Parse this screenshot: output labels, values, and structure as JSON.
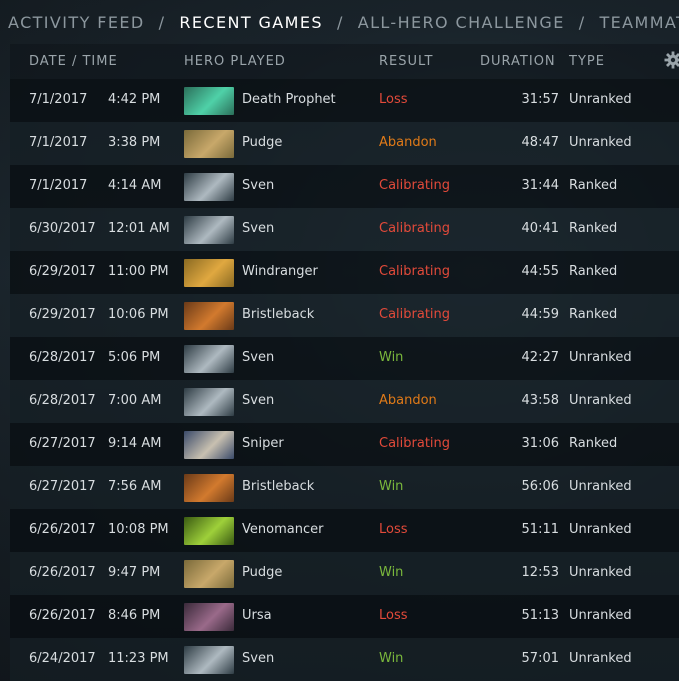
{
  "tabs": [
    {
      "label": "ACTIVITY FEED",
      "active": false
    },
    {
      "label": "RECENT GAMES",
      "active": true
    },
    {
      "label": "ALL-HERO CHALLENGE",
      "active": false
    },
    {
      "label": "TEAMMATES",
      "active": false
    }
  ],
  "tab_separator": "/",
  "columns": {
    "date_time": "DATE / TIME",
    "hero": "HERO PLAYED",
    "result": "RESULT",
    "duration": "DURATION",
    "type": "TYPE"
  },
  "settings_icon": "gear-icon",
  "result_colors": {
    "Loss": "#e24a3a",
    "Abandon": "#e07a18",
    "Calibrating": "#e24a3a",
    "Win": "#7ab83c"
  },
  "hero_colors": {
    "Death Prophet": [
      "#2b6f5a",
      "#4fd1a8"
    ],
    "Pudge": [
      "#7a6a3a",
      "#c8a86a"
    ],
    "Sven": [
      "#2e3c44",
      "#aeb9c0"
    ],
    "Windranger": [
      "#8a6a22",
      "#e0a840"
    ],
    "Bristleback": [
      "#6a3a18",
      "#d27a2e"
    ],
    "Sniper": [
      "#3a4a6a",
      "#c8c0b0"
    ],
    "Venomancer": [
      "#3a5a12",
      "#9ed03a"
    ],
    "Ursa": [
      "#3a2a3a",
      "#9a6a8a"
    ]
  },
  "matches": [
    {
      "date": "7/1/2017",
      "time": "4:42 PM",
      "hero": "Death Prophet",
      "result": "Loss",
      "duration": "31:57",
      "type": "Unranked"
    },
    {
      "date": "7/1/2017",
      "time": "3:38 PM",
      "hero": "Pudge",
      "result": "Abandon",
      "duration": "48:47",
      "type": "Unranked"
    },
    {
      "date": "7/1/2017",
      "time": "4:14 AM",
      "hero": "Sven",
      "result": "Calibrating",
      "duration": "31:44",
      "type": "Ranked"
    },
    {
      "date": "6/30/2017",
      "time": "12:01 AM",
      "hero": "Sven",
      "result": "Calibrating",
      "duration": "40:41",
      "type": "Ranked"
    },
    {
      "date": "6/29/2017",
      "time": "11:00 PM",
      "hero": "Windranger",
      "result": "Calibrating",
      "duration": "44:55",
      "type": "Ranked"
    },
    {
      "date": "6/29/2017",
      "time": "10:06 PM",
      "hero": "Bristleback",
      "result": "Calibrating",
      "duration": "44:59",
      "type": "Ranked"
    },
    {
      "date": "6/28/2017",
      "time": "5:06 PM",
      "hero": "Sven",
      "result": "Win",
      "duration": "42:27",
      "type": "Unranked"
    },
    {
      "date": "6/28/2017",
      "time": "7:00 AM",
      "hero": "Sven",
      "result": "Abandon",
      "duration": "43:58",
      "type": "Unranked"
    },
    {
      "date": "6/27/2017",
      "time": "9:14 AM",
      "hero": "Sniper",
      "result": "Calibrating",
      "duration": "31:06",
      "type": "Ranked"
    },
    {
      "date": "6/27/2017",
      "time": "7:56 AM",
      "hero": "Bristleback",
      "result": "Win",
      "duration": "56:06",
      "type": "Unranked"
    },
    {
      "date": "6/26/2017",
      "time": "10:08 PM",
      "hero": "Venomancer",
      "result": "Loss",
      "duration": "51:11",
      "type": "Unranked"
    },
    {
      "date": "6/26/2017",
      "time": "9:47 PM",
      "hero": "Pudge",
      "result": "Win",
      "duration": "12:53",
      "type": "Unranked"
    },
    {
      "date": "6/26/2017",
      "time": "8:46 PM",
      "hero": "Ursa",
      "result": "Loss",
      "duration": "51:13",
      "type": "Unranked"
    },
    {
      "date": "6/24/2017",
      "time": "11:23 PM",
      "hero": "Sven",
      "result": "Win",
      "duration": "57:01",
      "type": "Unranked"
    }
  ]
}
